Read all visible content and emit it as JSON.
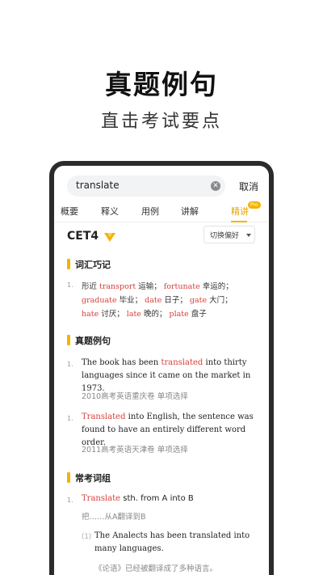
{
  "hero": {
    "title": "真题例句",
    "subtitle": "直击考试要点"
  },
  "search": {
    "query": "translate",
    "cancel_label": "取消"
  },
  "tabs": [
    {
      "label": "概要"
    },
    {
      "label": "释义"
    },
    {
      "label": "用例"
    },
    {
      "label": "讲解"
    },
    {
      "label": "精讲",
      "badge": "Pro"
    }
  ],
  "exam": {
    "tag": "CET4",
    "preference_label": "切换偏好"
  },
  "vocab": {
    "title": "词汇巧记",
    "number": "1.",
    "line1": [
      {
        "text": "形近 ",
        "style": "cn"
      },
      {
        "text": "transport",
        "style": "red"
      },
      {
        "text": " 运输； ",
        "style": "cn"
      },
      {
        "text": "fortunate",
        "style": "red"
      },
      {
        "text": " 幸运的；",
        "style": "cn"
      }
    ],
    "line2": [
      {
        "text": "graduate",
        "style": "red"
      },
      {
        "text": " 毕业； ",
        "style": "cn"
      },
      {
        "text": "date",
        "style": "red"
      },
      {
        "text": " 日子； ",
        "style": "cn"
      },
      {
        "text": "gate",
        "style": "red"
      },
      {
        "text": " 大门；",
        "style": "cn"
      }
    ],
    "line3": [
      {
        "text": "hate",
        "style": "red"
      },
      {
        "text": " 讨厌； ",
        "style": "cn"
      },
      {
        "text": "late",
        "style": "red"
      },
      {
        "text": " 晚的； ",
        "style": "cn"
      },
      {
        "text": "plate",
        "style": "red"
      },
      {
        "text": " 盘子",
        "style": "cn"
      }
    ]
  },
  "exam_sentences": {
    "title": "真题例句",
    "items": [
      {
        "number": "1.",
        "before": "The book has been ",
        "highlight": "translated",
        "after": " into thirty languages since it came on the market in 1973.",
        "source": "2010高考英语重庆卷 单项选择"
      },
      {
        "number": "1.",
        "before": "",
        "highlight": "Translated",
        "after": " into English, the sentence was found to have an entirely different word order.",
        "source": "2011高考英语天津卷 单项选择"
      }
    ]
  },
  "phrases": {
    "title": "常考词组",
    "number": "1.",
    "highlight": "Translate",
    "rest": " sth. from A into B",
    "meaning": "把……从A翻译到B",
    "example": {
      "number": "(1)",
      "sentence": "The Analects has been translated into many languages.",
      "translation": "《论语》已经被翻译成了多种语言。"
    }
  },
  "colors": {
    "accent": "#f2b400",
    "highlight": "#d6403a",
    "phone_frame": "#2b2b2b"
  }
}
